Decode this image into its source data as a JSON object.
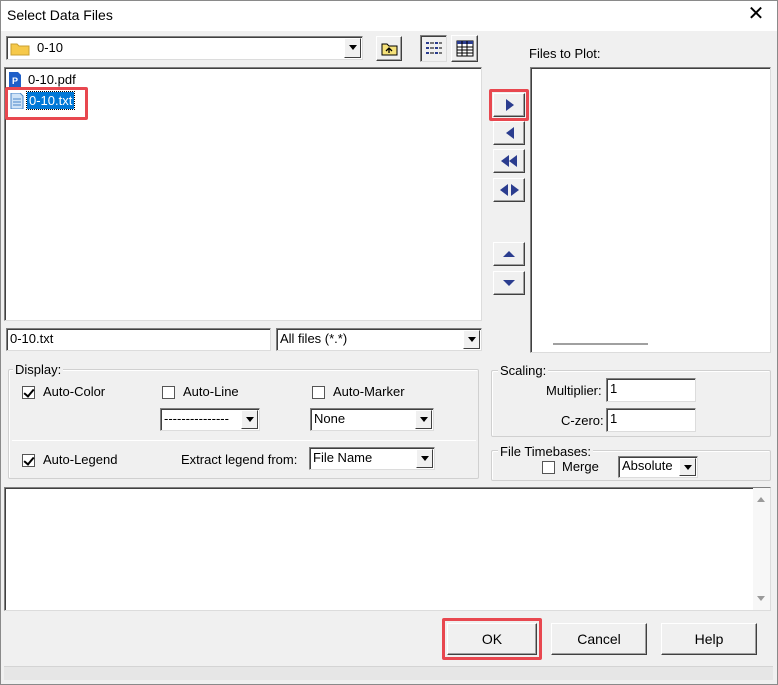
{
  "window": {
    "title": "Select Data Files"
  },
  "folder_combo": {
    "value": "0-10"
  },
  "files": [
    {
      "name": "0-10.pdf",
      "icon": "pdf-file-icon",
      "selected": false
    },
    {
      "name": "0-10.txt",
      "icon": "text-file-icon",
      "selected": true
    }
  ],
  "filename_field": {
    "value": "0-10.txt"
  },
  "filter_combo": {
    "value": "All files (*.*)"
  },
  "files_to_plot": {
    "label": "Files to Plot:"
  },
  "display": {
    "label": "Display:",
    "auto_color": {
      "label": "Auto-Color",
      "checked": true
    },
    "auto_line": {
      "label": "Auto-Line",
      "checked": false
    },
    "auto_marker": {
      "label": "Auto-Marker",
      "checked": false
    },
    "line_combo": {
      "value": "---------------"
    },
    "marker_combo": {
      "value": "None"
    },
    "auto_legend": {
      "label": "Auto-Legend",
      "checked": true
    },
    "extract_label": "Extract legend from:",
    "extract_combo": {
      "value": "File Name"
    }
  },
  "scaling": {
    "label": "Scaling:",
    "multiplier_label": "Multiplier:",
    "multiplier_value": "1",
    "czero_label": "C-zero:",
    "czero_value": "1"
  },
  "timebases": {
    "label": "File Timebases:",
    "merge_label": "Merge",
    "merge_checked": false,
    "mode_combo": {
      "value": "Absolute"
    }
  },
  "buttons": {
    "ok": "OK",
    "cancel": "Cancel",
    "help": "Help"
  },
  "colors": {
    "selection": "#0078d7",
    "highlight": "#e8474f",
    "nav_arrow": "#2b3d8f"
  }
}
